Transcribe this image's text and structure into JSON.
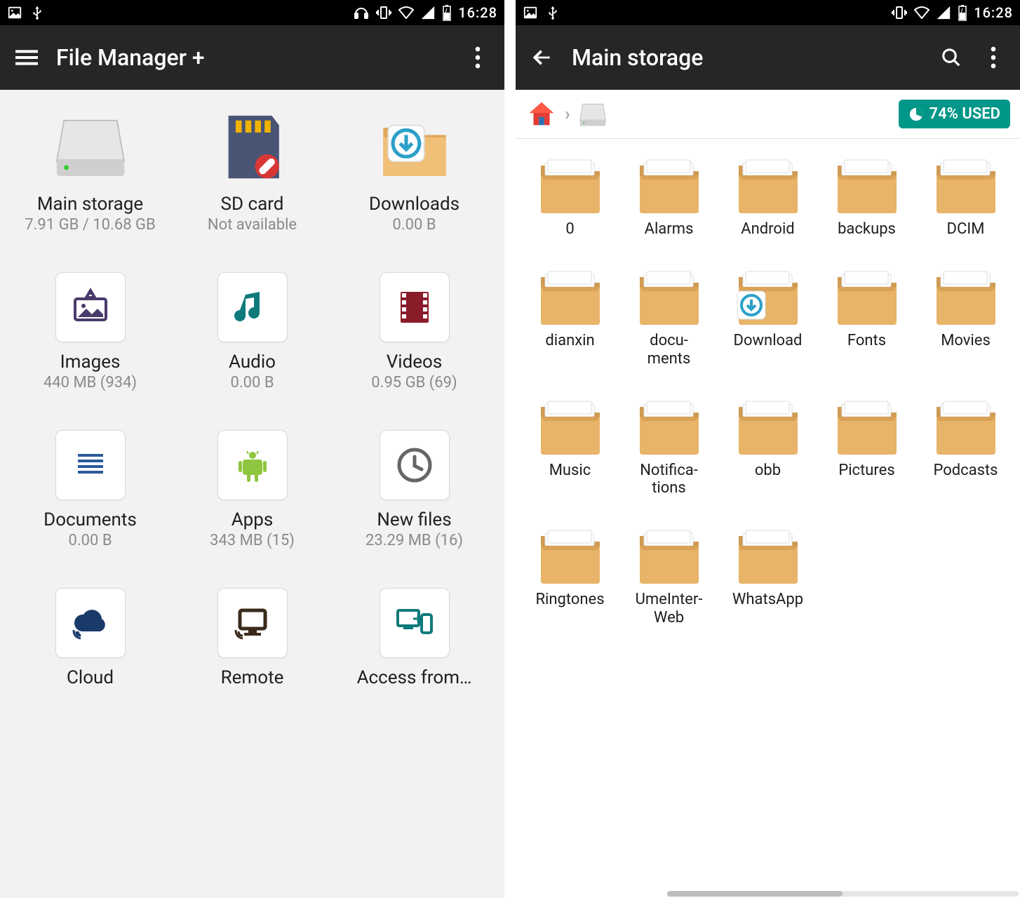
{
  "status": {
    "time": "16:28"
  },
  "left": {
    "title": "File Manager +",
    "tiles": [
      {
        "label": "Main storage",
        "sub": "7.91 GB / 10.68 GB",
        "icon": "drive"
      },
      {
        "label": "SD card",
        "sub": "Not available",
        "icon": "sdcard"
      },
      {
        "label": "Downloads",
        "sub": "0.00 B",
        "icon": "download-folder"
      },
      {
        "label": "Images",
        "sub": "440 MB (934)",
        "icon": "images",
        "card": true
      },
      {
        "label": "Audio",
        "sub": "0.00 B",
        "icon": "audio",
        "card": true
      },
      {
        "label": "Videos",
        "sub": "0.95 GB (69)",
        "icon": "video",
        "card": true
      },
      {
        "label": "Documents",
        "sub": "0.00 B",
        "icon": "documents",
        "card": true
      },
      {
        "label": "Apps",
        "sub": "343 MB (15)",
        "icon": "apps",
        "card": true
      },
      {
        "label": "New files",
        "sub": "23.29 MB (16)",
        "icon": "clock",
        "card": true
      },
      {
        "label": "Cloud",
        "sub": "",
        "icon": "cloud",
        "card": true
      },
      {
        "label": "Remote",
        "sub": "",
        "icon": "remote",
        "card": true
      },
      {
        "label": "Access from…",
        "sub": "",
        "icon": "access",
        "card": true
      }
    ]
  },
  "right": {
    "title": "Main storage",
    "usage": "74% USED",
    "folders": [
      "0",
      "Alarms",
      "Android",
      "backups",
      "DCIM",
      "dianxin",
      "docu­ments",
      "Download",
      "Fonts",
      "Movies",
      "Music",
      "Notifica­tions",
      "obb",
      "Pictures",
      "Podcasts",
      "Ringtones",
      "UmeInter­Web",
      "WhatsApp"
    ],
    "download_index": 7
  }
}
